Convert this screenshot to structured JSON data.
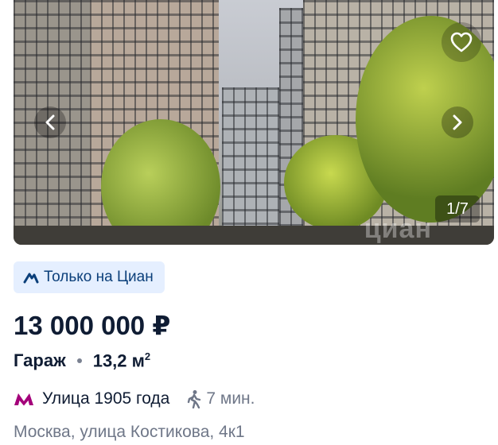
{
  "gallery": {
    "counter": "1/7",
    "watermark": "циан"
  },
  "badge": {
    "label": "Только на Циан"
  },
  "listing": {
    "price": "13 000 000 ₽",
    "type": "Гараж",
    "area": "13,2 м",
    "area_sup": "2"
  },
  "location": {
    "metro_station": "Улица 1905 года",
    "walk_time": "7 мин.",
    "address": "Москва, улица Костикова, 4к1"
  },
  "colors": {
    "metro_line": "#a4007a",
    "badge_bg": "#e5efff",
    "brand_blue": "#0b3f7a"
  },
  "icons": {
    "prev": "chevron-left-icon",
    "next": "chevron-right-icon",
    "favorite": "heart-icon",
    "badge": "cian-logo-icon",
    "metro": "metro-icon",
    "walk": "walking-person-icon"
  }
}
